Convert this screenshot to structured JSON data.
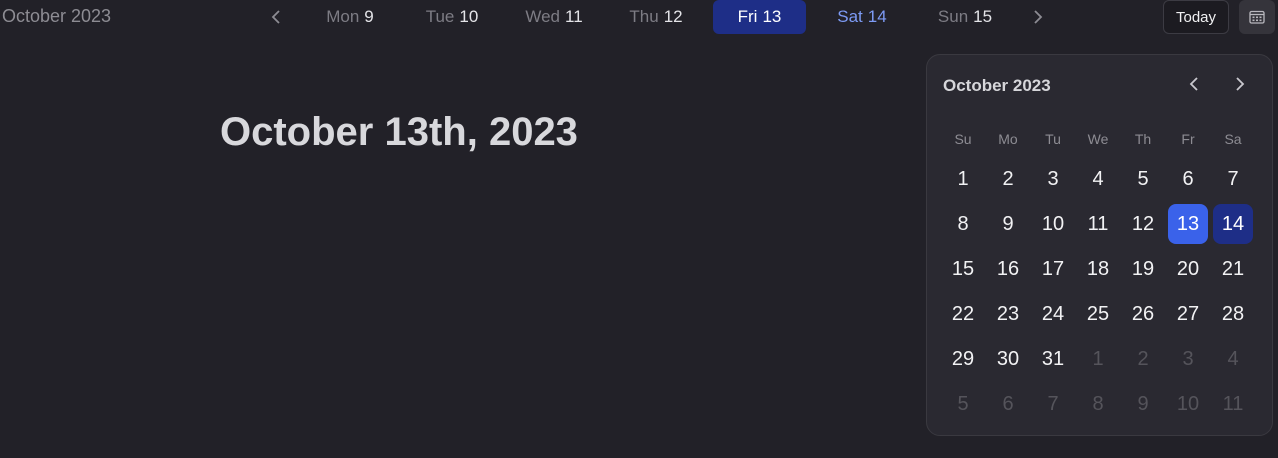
{
  "header": {
    "month_label": "October 2023",
    "prev_icon": "chevron-left-icon",
    "next_icon": "chevron-right-icon",
    "days": [
      {
        "weekday": "Mon",
        "day": "9"
      },
      {
        "weekday": "Tue",
        "day": "10"
      },
      {
        "weekday": "Wed",
        "day": "11"
      },
      {
        "weekday": "Thu",
        "day": "12"
      },
      {
        "weekday": "Fri",
        "day": "13"
      },
      {
        "weekday": "Sat",
        "day": "14"
      },
      {
        "weekday": "Sun",
        "day": "15"
      }
    ],
    "today_label": "Today",
    "calendar_icon": "calendar-icon"
  },
  "main": {
    "title": "October 13th, 2023"
  },
  "popover": {
    "title": "October 2023",
    "weekdays": [
      "Su",
      "Mo",
      "Tu",
      "We",
      "Th",
      "Fr",
      "Sa"
    ],
    "weeks": [
      [
        "1",
        "2",
        "3",
        "4",
        "5",
        "6",
        "7"
      ],
      [
        "8",
        "9",
        "10",
        "11",
        "12",
        "13",
        "14"
      ],
      [
        "15",
        "16",
        "17",
        "18",
        "19",
        "20",
        "21"
      ],
      [
        "22",
        "23",
        "24",
        "25",
        "26",
        "27",
        "28"
      ],
      [
        "29",
        "30",
        "31",
        "1",
        "2",
        "3",
        "4"
      ],
      [
        "5",
        "6",
        "7",
        "8",
        "9",
        "10",
        "11"
      ]
    ],
    "selected_day": "13",
    "range_day": "14"
  },
  "colors": {
    "background": "#222128",
    "active_tab": "#1e2e87",
    "selected_day": "#3a62ea",
    "highlight_text": "#7d9bf5"
  }
}
